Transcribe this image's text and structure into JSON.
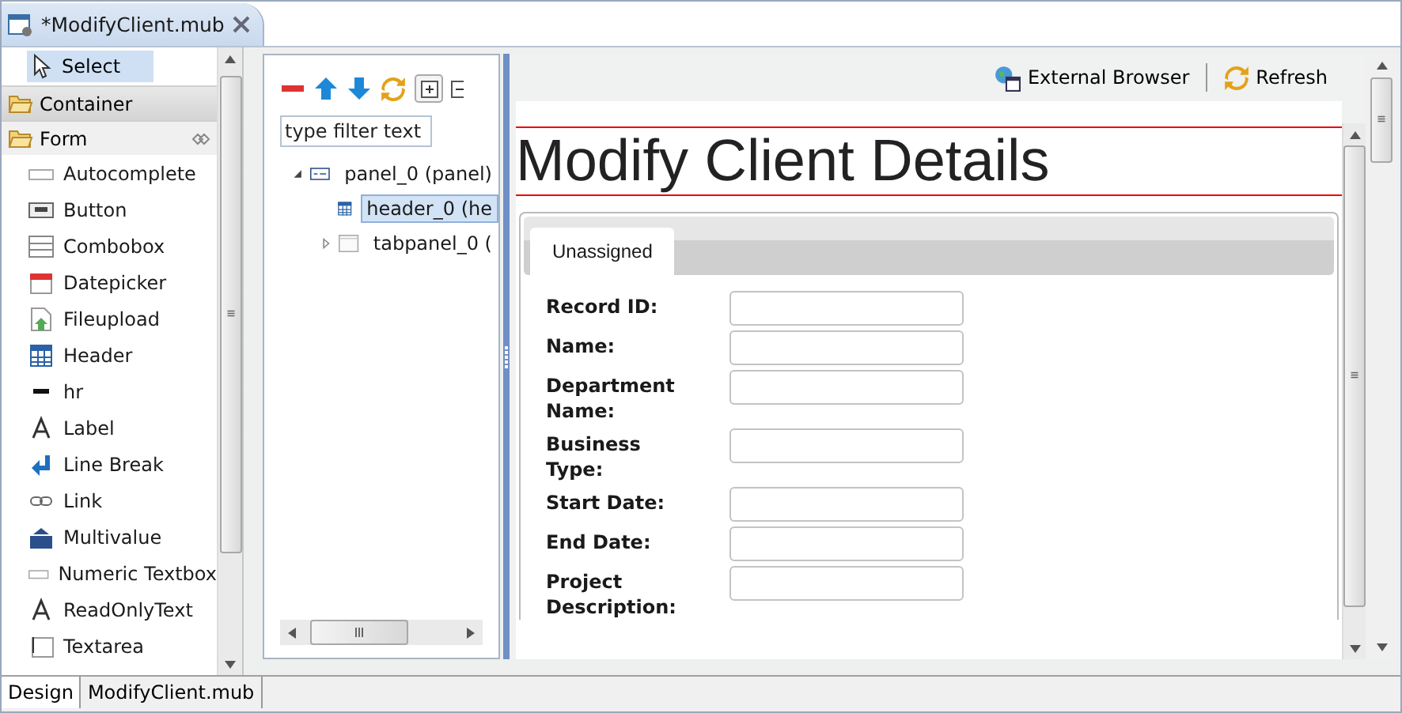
{
  "editor_tab": {
    "title": "*ModifyClient.mub"
  },
  "palette": {
    "select": {
      "label": "Select",
      "selected": true
    },
    "drawers": [
      {
        "label": "Container",
        "expanded": false
      },
      {
        "label": "Form",
        "expanded": true,
        "items": [
          {
            "label": "Autocomplete",
            "kind": "textbox"
          },
          {
            "label": "Button",
            "kind": "button"
          },
          {
            "label": "Combobox",
            "kind": "combo"
          },
          {
            "label": "Datepicker",
            "kind": "calendar"
          },
          {
            "label": "Fileupload",
            "kind": "upload"
          },
          {
            "label": "Header",
            "kind": "table"
          },
          {
            "label": "hr",
            "kind": "rule"
          },
          {
            "label": "Label",
            "kind": "letter"
          },
          {
            "label": "Line Break",
            "kind": "linebreak"
          },
          {
            "label": "Link",
            "kind": "link"
          },
          {
            "label": "Multivalue",
            "kind": "multi"
          },
          {
            "label": "Numeric Textbox",
            "kind": "textbox"
          },
          {
            "label": "ReadOnlyText",
            "kind": "letter"
          },
          {
            "label": "Textarea",
            "kind": "textarea"
          }
        ]
      }
    ]
  },
  "outline": {
    "filter": {
      "placeholder": "type filter text"
    },
    "tree": [
      {
        "label": "panel_0 (panel)",
        "kind": "panel",
        "expanded": true,
        "selected": false,
        "children": [
          {
            "label": "header_0 (he",
            "kind": "table",
            "selected": true
          },
          {
            "label": "tabpanel_0 (",
            "kind": "tabpanel",
            "expanded": false,
            "selected": false
          }
        ]
      }
    ]
  },
  "preview": {
    "toolbar": [
      {
        "label": "External Browser",
        "kind": "browser"
      },
      {
        "label": "Refresh",
        "kind": "refresh"
      }
    ],
    "heading": "Modify Client Details",
    "tabs": [
      {
        "label": "Unassigned",
        "selected": true
      }
    ],
    "fields": [
      {
        "label": "Record ID:"
      },
      {
        "label": "Name:"
      },
      {
        "label": "Department Name:"
      },
      {
        "label": "Business Type:"
      },
      {
        "label": "Start Date:"
      },
      {
        "label": "End Date:"
      },
      {
        "label": "Project Description:"
      }
    ]
  },
  "bottom_tabs": [
    {
      "label": "Design",
      "selected": true
    },
    {
      "label": "ModifyClient.mub",
      "selected": false
    }
  ]
}
